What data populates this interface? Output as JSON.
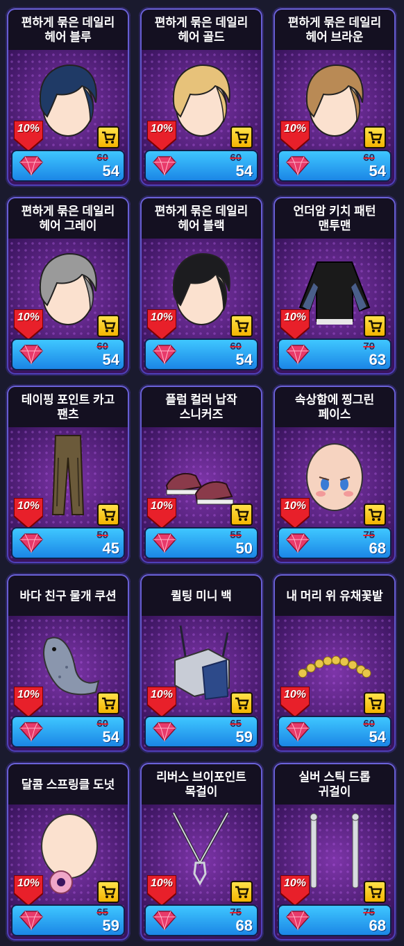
{
  "shop": {
    "items": [
      {
        "name": "편하게 묶은 데일리\n헤어 블루",
        "icon": "hair-blue-icon",
        "discount": "10%",
        "old_price": "60",
        "price": "54",
        "art": "hair",
        "color": "#1f3a66"
      },
      {
        "name": "편하게 묶은 데일리\n헤어 골드",
        "icon": "hair-gold-icon",
        "discount": "10%",
        "old_price": "60",
        "price": "54",
        "art": "hair",
        "color": "#e7c27a"
      },
      {
        "name": "편하게 묶은 데일리\n헤어 브라운",
        "icon": "hair-brown-icon",
        "discount": "10%",
        "old_price": "60",
        "price": "54",
        "art": "hair",
        "color": "#b98a55"
      },
      {
        "name": "편하게 묶은 데일리\n헤어 그레이",
        "icon": "hair-gray-icon",
        "discount": "10%",
        "old_price": "60",
        "price": "54",
        "art": "hair",
        "color": "#9a9a9a"
      },
      {
        "name": "편하게 묶은 데일리\n헤어 블랙",
        "icon": "hair-black-icon",
        "discount": "10%",
        "old_price": "60",
        "price": "54",
        "art": "hair",
        "color": "#1c1c1f"
      },
      {
        "name": "언더암 키치 패턴\n맨투맨",
        "icon": "sweatshirt-icon",
        "discount": "10%",
        "old_price": "70",
        "price": "63",
        "art": "shirt",
        "color": "#1a1a1a"
      },
      {
        "name": "테이핑 포인트 카고\n팬츠",
        "icon": "cargo-pants-icon",
        "discount": "10%",
        "old_price": "50",
        "price": "45",
        "art": "pants",
        "color": "#6b5a3a"
      },
      {
        "name": "플럼 컬러 납작\n스니커즈",
        "icon": "sneakers-icon",
        "discount": "10%",
        "old_price": "55",
        "price": "50",
        "art": "shoes",
        "color": "#8a3a4a"
      },
      {
        "name": "속상함에 찡그린\n페이스",
        "icon": "face-icon",
        "discount": "10%",
        "old_price": "75",
        "price": "68",
        "art": "face",
        "color": "#f6d3c0"
      },
      {
        "name": "바다 친구 물개 쿠션",
        "icon": "seal-cushion-icon",
        "discount": "10%",
        "old_price": "60",
        "price": "54",
        "art": "seal",
        "color": "#8a96ad"
      },
      {
        "name": "퀼팅 미니 백",
        "icon": "mini-bag-icon",
        "discount": "10%",
        "old_price": "65",
        "price": "59",
        "art": "bag",
        "color": "#c8ccd6"
      },
      {
        "name": "내 머리 위 유채꽃밭",
        "icon": "flower-crown-icon",
        "discount": "10%",
        "old_price": "60",
        "price": "54",
        "art": "flowers",
        "color": "#e8c64a"
      },
      {
        "name": "달콤 스프링클 도넛",
        "icon": "donut-icon",
        "discount": "10%",
        "old_price": "65",
        "price": "59",
        "art": "donut",
        "color": "#f0a6c8"
      },
      {
        "name": "리버스 브이포인트\n목걸이",
        "icon": "necklace-icon",
        "discount": "10%",
        "old_price": "75",
        "price": "68",
        "art": "necklace",
        "color": "#cfd3da"
      },
      {
        "name": "실버 스틱 드롭\n귀걸이",
        "icon": "earrings-icon",
        "discount": "10%",
        "old_price": "75",
        "price": "68",
        "art": "earrings",
        "color": "#d8dbe0"
      }
    ]
  }
}
